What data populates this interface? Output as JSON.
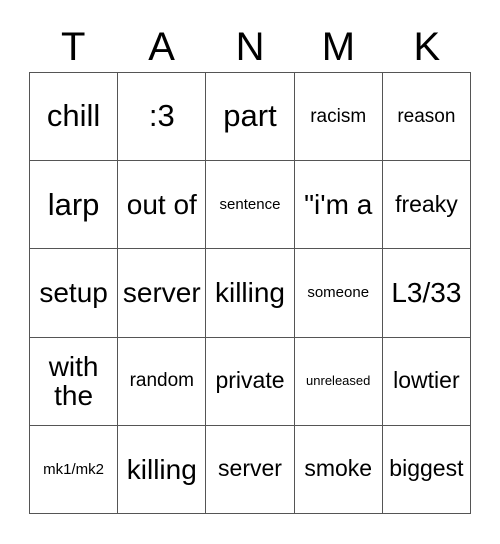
{
  "card": {
    "title_letters": [
      "T",
      "A",
      "N",
      "M",
      "K"
    ],
    "columns": 5,
    "rows": 5,
    "colors": {
      "background": "#ffffff",
      "grid_line": "#555555",
      "text": "#000000"
    },
    "cells": [
      [
        {
          "text": "chill",
          "size": "fs-xl"
        },
        {
          "text": ":3",
          "size": "fs-xl"
        },
        {
          "text": "part",
          "size": "fs-xl"
        },
        {
          "text": "racism",
          "size": "fs-sm"
        },
        {
          "text": "reason",
          "size": "fs-sm"
        }
      ],
      [
        {
          "text": "larp",
          "size": "fs-xl"
        },
        {
          "text": "out of",
          "size": "fs-lg"
        },
        {
          "text": "sentence",
          "size": "fs-xs"
        },
        {
          "text": "\"i'm a",
          "size": "fs-lg"
        },
        {
          "text": "freaky",
          "size": "fs-md"
        }
      ],
      [
        {
          "text": "setup",
          "size": "fs-lg"
        },
        {
          "text": "server",
          "size": "fs-lg"
        },
        {
          "text": "killing",
          "size": "fs-lg"
        },
        {
          "text": "someone",
          "size": "fs-xs"
        },
        {
          "text": "L3/33",
          "size": "fs-lg"
        }
      ],
      [
        {
          "text": "with the",
          "size": "fs-lg"
        },
        {
          "text": "random",
          "size": "fs-sm"
        },
        {
          "text": "private",
          "size": "fs-md"
        },
        {
          "text": "unreleased",
          "size": "fs-xxs"
        },
        {
          "text": "lowtier",
          "size": "fs-md"
        }
      ],
      [
        {
          "text": "mk1/mk2",
          "size": "fs-xs"
        },
        {
          "text": "killing",
          "size": "fs-lg"
        },
        {
          "text": "server",
          "size": "fs-md"
        },
        {
          "text": "smoke",
          "size": "fs-md"
        },
        {
          "text": "biggest",
          "size": "fs-md"
        }
      ]
    ]
  }
}
